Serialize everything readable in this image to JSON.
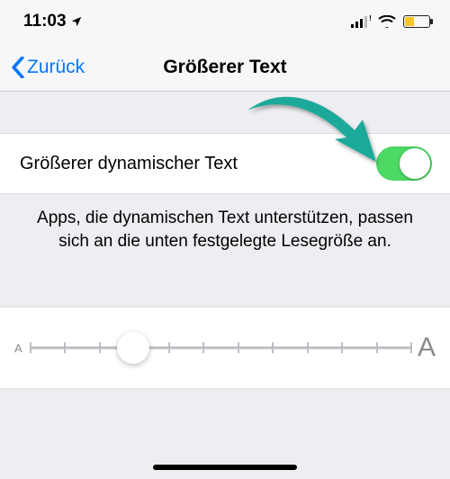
{
  "status": {
    "time": "11:03",
    "location_arrow": "➤",
    "battery_percent": 35,
    "battery_color": "#f8c52a"
  },
  "nav": {
    "back_label": "Zurück",
    "title": "Größerer Text"
  },
  "setting": {
    "label": "Größerer dynamischer Text",
    "value": true
  },
  "footer": "Apps, die dynamischen Text unterstützen, passen sich an die unten festgelegte Lesegröße an.",
  "slider": {
    "min_glyph": "A",
    "max_glyph": "A",
    "steps": 12,
    "position": 3
  },
  "colors": {
    "ios_blue": "#0076ff",
    "ios_green": "#4cd964",
    "arrow": "#1ea99a"
  }
}
